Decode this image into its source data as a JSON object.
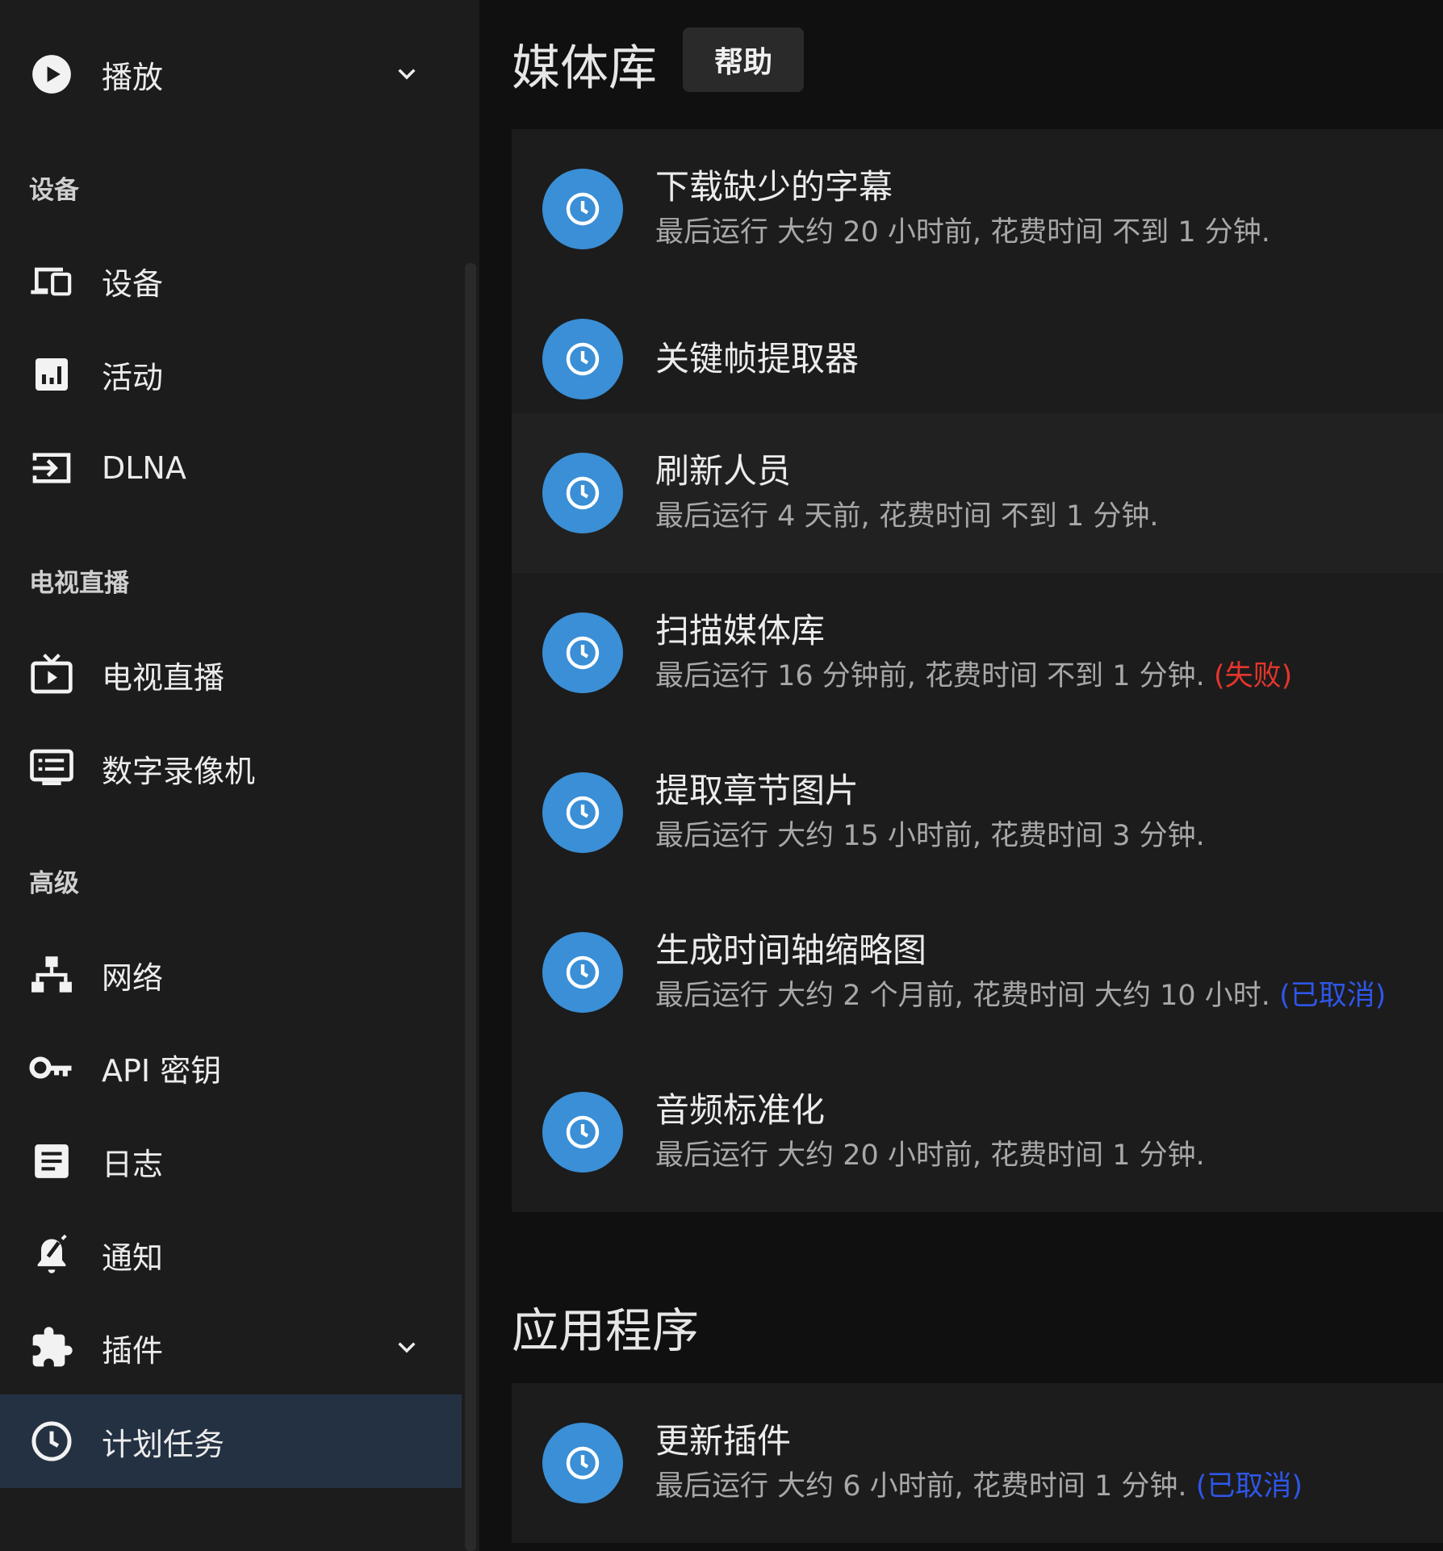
{
  "sidebar": {
    "top_item": {
      "label": "播放",
      "icon": "play-circle-icon"
    },
    "sections": [
      {
        "title": "设备",
        "items": [
          {
            "label": "设备",
            "icon": "devices-icon"
          },
          {
            "label": "活动",
            "icon": "activity-chart-icon"
          },
          {
            "label": "DLNA",
            "icon": "input-arrow-icon"
          }
        ]
      },
      {
        "title": "电视直播",
        "items": [
          {
            "label": "电视直播",
            "icon": "live-tv-icon"
          },
          {
            "label": "数字录像机",
            "icon": "dvr-icon"
          }
        ]
      },
      {
        "title": "高级",
        "items": [
          {
            "label": "网络",
            "icon": "network-icon"
          },
          {
            "label": "API 密钥",
            "icon": "key-icon"
          },
          {
            "label": "日志",
            "icon": "log-document-icon"
          },
          {
            "label": "通知",
            "icon": "notification-bell-icon"
          },
          {
            "label": "插件",
            "icon": "puzzle-icon"
          },
          {
            "label": "计划任务",
            "icon": "clock-icon"
          }
        ]
      }
    ]
  },
  "main": {
    "title": "媒体库",
    "help_label": "帮助",
    "library_tasks": [
      {
        "name": "下载缺少的字幕",
        "meta": "最后运行 大约 20 小时前, 花费时间 不到 1 分钟.",
        "status": ""
      },
      {
        "name": "关键帧提取器",
        "meta": "",
        "status": ""
      },
      {
        "name": "刷新人员",
        "meta": "最后运行 4 天前, 花费时间 不到 1 分钟.",
        "status": ""
      },
      {
        "name": "扫描媒体库",
        "meta": "最后运行 16 分钟前, 花费时间 不到 1 分钟.",
        "status": "(失败)"
      },
      {
        "name": "提取章节图片",
        "meta": "最后运行 大约 15 小时前, 花费时间 3 分钟.",
        "status": ""
      },
      {
        "name": "生成时间轴缩略图",
        "meta": "最后运行 大约 2 个月前, 花费时间 大约 10 小时.",
        "status": "(已取消)"
      },
      {
        "name": "音频标准化",
        "meta": "最后运行 大约 20 小时前, 花费时间 1 分钟.",
        "status": ""
      }
    ],
    "app_section_title": "应用程序",
    "app_tasks": [
      {
        "name": "更新插件",
        "meta": "最后运行 大约 6 小时前, 花费时间 1 分钟.",
        "status": "(已取消)"
      }
    ]
  },
  "colors": {
    "accent": "#3a8fd6",
    "fail": "#e5352c",
    "cancel": "#2e56e8",
    "active_bg": "#243142"
  }
}
